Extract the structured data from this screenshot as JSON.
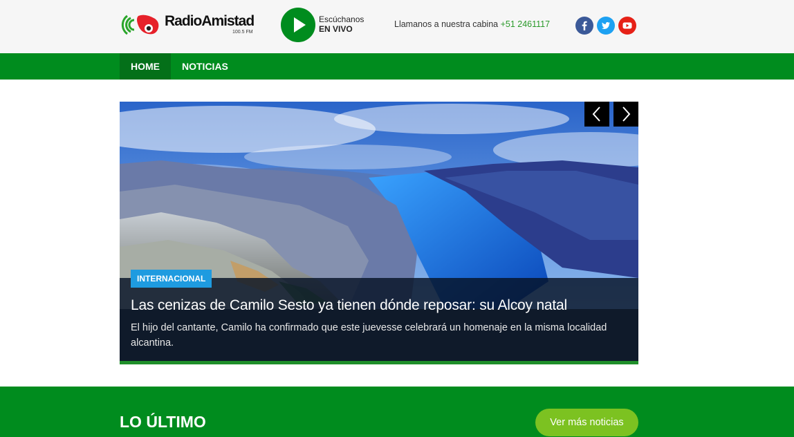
{
  "header": {
    "logo_name": "RadioAmistad",
    "logo_sub": "100.5 FM",
    "live_line1": "Escúchanos",
    "live_line2": "EN VIVO",
    "cabina_text": "Llamanos a nuestra cabina ",
    "cabina_phone": "+51 2461117",
    "social": [
      "facebook-icon",
      "twitter-icon",
      "youtube-icon"
    ]
  },
  "nav": {
    "items": [
      {
        "label": "HOME",
        "active": true
      },
      {
        "label": "NOTICIAS",
        "active": false
      }
    ]
  },
  "slider": {
    "category": "INTERNACIONAL",
    "title": "Las cenizas de Camilo Sesto ya tienen dónde reposar: su Alcoy natal",
    "description": "El hijo del cantante, Camilo ha confirmado que este juevesse celebrará un homenaje en la misma localidad alcantina."
  },
  "latest": {
    "title": "LO ÚLTIMO",
    "more_label": "Ver más noticias"
  },
  "colors": {
    "brand_green": "#008c1e",
    "nav_active": "#047019",
    "badge_blue": "#1e9be0",
    "button_lime": "#7cc221"
  }
}
